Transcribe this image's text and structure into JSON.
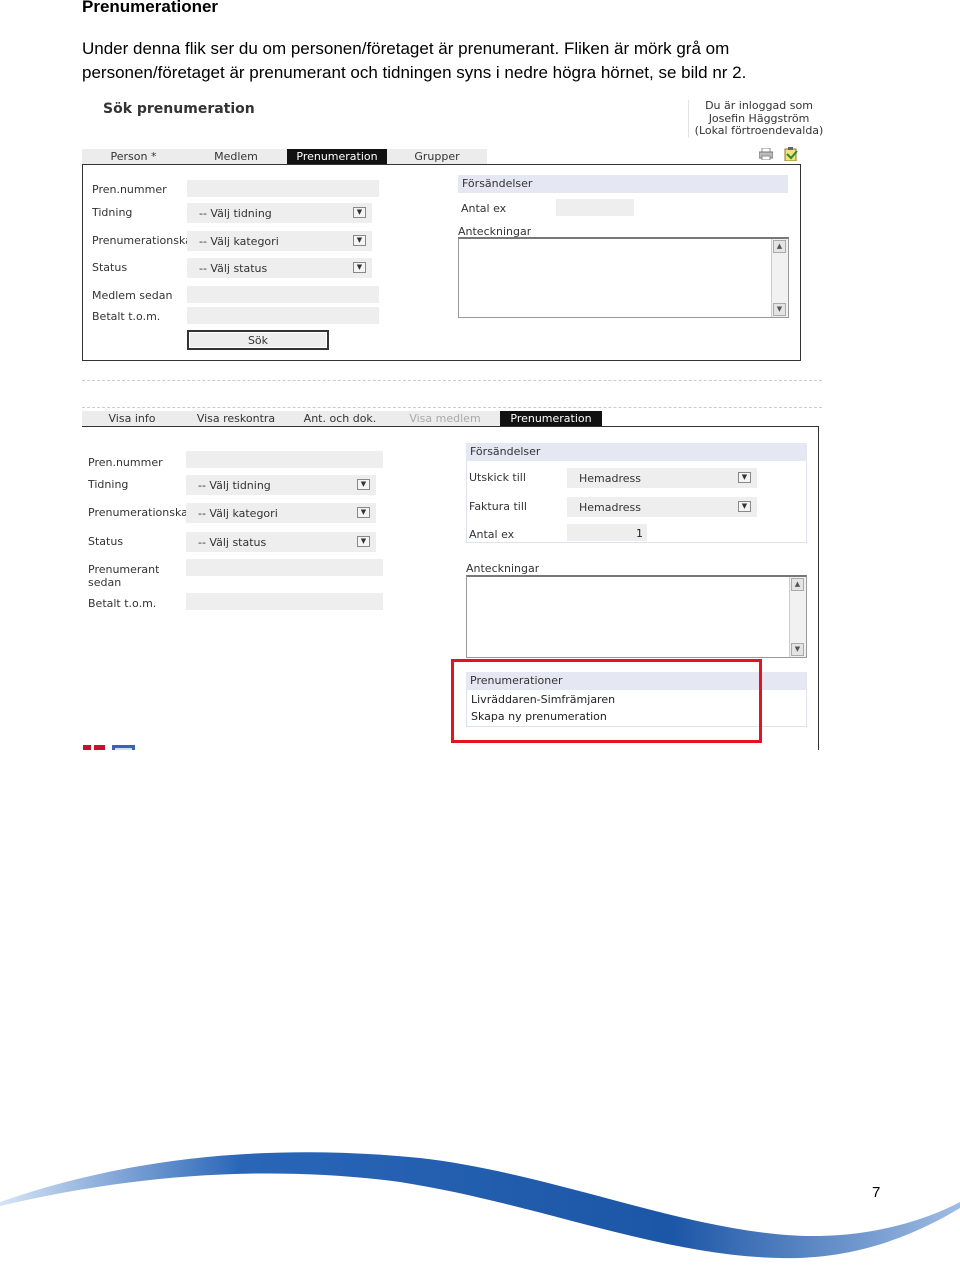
{
  "document": {
    "heading": "Prenumerationer",
    "paragraph": "Under denna flik ser du om personen/företaget är prenumerant. Fliken är mörk grå om personen/företaget är prenumerant och tidningen syns i nedre högra hörnet, se bild nr 2.",
    "page_number": "7"
  },
  "screenshot1": {
    "title": "Sök prenumeration",
    "login": {
      "line1": "Du är inloggad som",
      "line2": "Josefin Häggström",
      "line3": "(Lokal förtroendevalda)"
    },
    "tabs": [
      "Person *",
      "Medlem",
      "Prenumeration",
      "Grupper"
    ],
    "active_tab": "Prenumeration",
    "labels": {
      "pren_nummer": "Pren.nummer",
      "tidning": "Tidning",
      "kategori": "Prenumerationskategori",
      "status": "Status",
      "medlem_sedan": "Medlem sedan",
      "betalt": "Betalt t.o.m."
    },
    "selects": {
      "tidning": "-- Välj tidning",
      "kategori": "-- Välj kategori",
      "status": "-- Välj status"
    },
    "search_button": "Sök",
    "forsandelser": "Försändelser",
    "antal_ex_label": "Antal ex",
    "anteckningar": "Anteckningar"
  },
  "screenshot2": {
    "tabs": [
      "Visa info",
      "Visa reskontra",
      "Ant. och dok.",
      "Visa medlem",
      "Prenumeration"
    ],
    "active_tab": "Prenumeration",
    "dim_tab": "Visa medlem",
    "labels": {
      "pren_nummer": "Pren.nummer",
      "tidning": "Tidning",
      "kategori": "Prenumerationskategori",
      "status": "Status",
      "prenumerant_line1": "Prenumerant",
      "prenumerant_line2": "sedan",
      "betalt": "Betalt t.o.m."
    },
    "selects": {
      "tidning": "-- Välj tidning",
      "kategori": "-- Välj kategori",
      "status": "-- Välj status"
    },
    "forsandelser": {
      "header": "Försändelser",
      "utskick_label": "Utskick till",
      "utskick_value": "Hemadress",
      "faktura_label": "Faktura till",
      "faktura_value": "Hemadress",
      "antal_label": "Antal ex",
      "antal_value": "1"
    },
    "anteckningar": "Anteckningar",
    "prenumerationer": {
      "header": "Prenumerationer",
      "items": [
        "Livräddaren-Simfrämjaren",
        "Skapa ny prenumeration"
      ]
    }
  },
  "colors": {
    "highlight": "#e3141e",
    "section_header": "#e5e7f3",
    "wave_blue": "#1f5aa8"
  }
}
